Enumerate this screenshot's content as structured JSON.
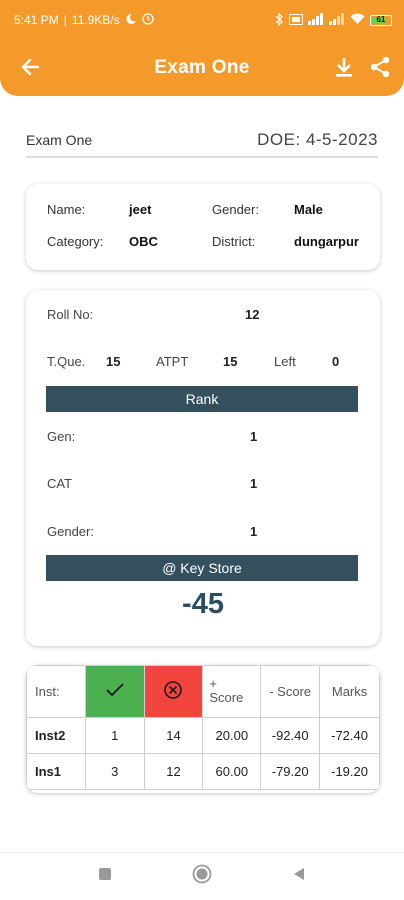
{
  "status": {
    "time": "5:41 PM",
    "speed": "11.9KB/s",
    "battery": "61"
  },
  "appbar": {
    "title": "Exam One"
  },
  "exam": {
    "name": "Exam One",
    "doe": "DOE: 4-5-2023"
  },
  "student": {
    "name_label": "Name:",
    "name": "jeet",
    "gender_label": "Gender:",
    "gender": "Male",
    "category_label": "Category:",
    "category": "OBC",
    "district_label": "District:",
    "district": "dungarpur"
  },
  "result": {
    "roll_label": "Roll No:",
    "roll": "12",
    "tque_label": "T.Que.",
    "tque": "15",
    "atpt_label": "ATPT",
    "atpt": "15",
    "left_label": "Left",
    "left": "0",
    "rank_title": "Rank",
    "gen_label": "Gen:",
    "gen_rank": "1",
    "cat_label": "CAT",
    "cat_rank": "1",
    "gender_label": "Gender:",
    "gender_rank": "1",
    "key_store": "@ Key Store",
    "total_score": "-45"
  },
  "score_table": {
    "headers": {
      "inst": "Inst:",
      "plus_score_sign": "+",
      "plus_score": "Score",
      "minus_score": "- Score",
      "marks": "Marks"
    },
    "rows": [
      {
        "inst": "Inst2",
        "correct": "1",
        "wrong": "14",
        "plus": "20.00",
        "minus": "-92.40",
        "marks": "-72.40"
      },
      {
        "inst": "Ins1",
        "correct": "3",
        "wrong": "12",
        "plus": "60.00",
        "minus": "-79.20",
        "marks": "-19.20"
      }
    ]
  },
  "colors": {
    "primary": "#F39A2B",
    "banner": "#34505f",
    "correct": "#4CAF50",
    "wrong": "#F2453D"
  },
  "icons": {
    "back": "back-arrow-icon",
    "download": "download-icon",
    "share": "share-icon",
    "correct": "check-icon",
    "wrong": "cross-circle-icon"
  }
}
